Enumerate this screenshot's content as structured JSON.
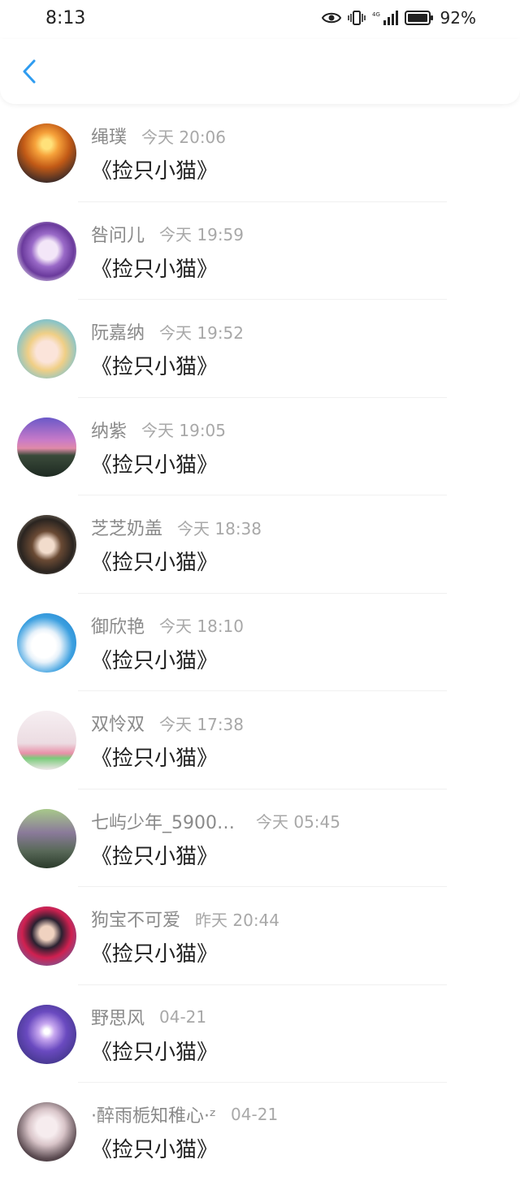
{
  "status_bar": {
    "time": "8:13",
    "battery": "92%",
    "network": "4G",
    "icons": [
      "eye-icon",
      "vibrate-icon",
      "signal-icon",
      "battery-icon"
    ]
  },
  "nav": {
    "back_icon": "chevron-left-icon",
    "accent": "#2f9cf0"
  },
  "comments": [
    {
      "name": "绳璞",
      "time": "今天 20:06",
      "text": "《捡只小猫》"
    },
    {
      "name": "咎问儿",
      "time": "今天 19:59",
      "text": "《捡只小猫》"
    },
    {
      "name": "阮嘉纳",
      "time": "今天 19:52",
      "text": "《捡只小猫》"
    },
    {
      "name": "纳紫",
      "time": "今天 19:05",
      "text": "《捡只小猫》"
    },
    {
      "name": "芝芝奶盖",
      "time": "今天 18:38",
      "text": "《捡只小猫》"
    },
    {
      "name": "御欣艳",
      "time": "今天 18:10",
      "text": "《捡只小猫》"
    },
    {
      "name": "双怜双",
      "time": "今天 17:38",
      "text": "《捡只小猫》"
    },
    {
      "name": "七屿少年_5900…",
      "time": "今天 05:45",
      "text": "《捡只小猫》"
    },
    {
      "name": "狗宝不可爱",
      "time": "昨天 20:44",
      "text": "《捡只小猫》"
    },
    {
      "name": "野思风",
      "time": "04-21",
      "text": "《捡只小猫》"
    },
    {
      "name": "·醉雨栀知稚心·ᶻ",
      "time": "04-21",
      "text": "《捡只小猫》"
    }
  ]
}
